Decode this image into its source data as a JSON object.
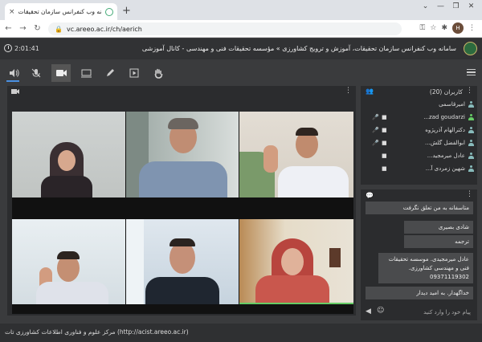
{
  "browser": {
    "tab_title": "سامانه وب کنفرانس سازمان تحقیقات",
    "tab_close": "×",
    "new_tab": "+",
    "url": "vc.areeo.ac.ir/ch/aerich",
    "avatar_initial": "H",
    "window_buttons": [
      "⌄",
      "—",
      "❐",
      "✕"
    ]
  },
  "header": {
    "timer": "2:01:41",
    "title": "سامانه وب کنفرانس سازمان تحقیقات، آموزش و ترویج کشاورزی » مؤسسه تحقیقات فنی و مهندسی - کانال آموزشی"
  },
  "toolbar": {
    "tools": [
      "speaker-icon",
      "mic-off-icon",
      "camera-icon",
      "screen-share-icon",
      "pen-icon",
      "media-icon",
      "hand-icon"
    ]
  },
  "participants": {
    "count_label": "کاربران (20)",
    "users": [
      {
        "name": "امیرقاسمی",
        "mic": false,
        "cam": false,
        "green": false
      },
      {
        "name": "zad goudarzi...",
        "mic": true,
        "cam": true,
        "green": true
      },
      {
        "name": "دکترالهام آذرپژوه",
        "mic": true,
        "cam": true,
        "green": false
      },
      {
        "name": "ابوالفضل گلش...",
        "mic": true,
        "cam": true,
        "green": false
      },
      {
        "name": "عادل میرمجید...",
        "mic": false,
        "cam": true,
        "green": false
      },
      {
        "name": "شهین زمردی آ...",
        "mic": false,
        "cam": true,
        "green": false
      }
    ]
  },
  "chat": {
    "messages": [
      "متاسفانه به من تعلق نگرفت",
      "شادی بصیری",
      "ترجمه",
      "عادل میرمجیدی. موسسه تحقیقات فنی و مهندسی کشاورزی. 09371119302",
      "خداگهدار. به امید دیدار"
    ],
    "placeholder": "پیام خود را وارد کنید"
  },
  "footer": {
    "text": "مرکز علوم و فناوری اطلاعات کشاورزی تات (http://acist.areeo.ac.ir)"
  },
  "colors": {
    "background": "#3a3b3d",
    "panel": "#2b2c2e",
    "header": "#313234",
    "accent_green": "#6c6"
  }
}
